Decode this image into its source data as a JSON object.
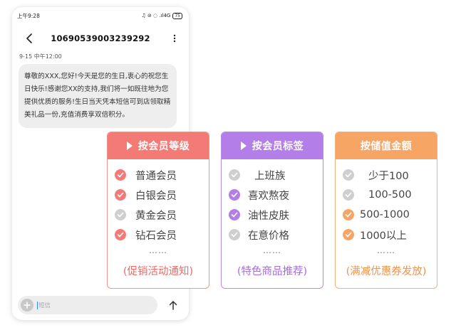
{
  "status_bar": {
    "time": "上午9:28",
    "icons": "♫ ⊘ ◌ .ıl4G",
    "battery": "75"
  },
  "header": {
    "title": "10690539003239292"
  },
  "conversation": {
    "date": "9-15  中午12:00",
    "message": "尊敬的XXX,您好!今天是您的生日,衷心的祝您生日快乐!感谢您XX的支持,我们将一如既往地为您提供优质的服务!生日当天凭本短信可到店领取精美礼品一份,充值消费享双倍积分。"
  },
  "composer": {
    "placeholder": "短信"
  },
  "cards": [
    {
      "title": "按会员等级",
      "accent": "#f47a76",
      "items": [
        {
          "label": "普通会员",
          "checked": true
        },
        {
          "label": "白银会员",
          "checked": true
        },
        {
          "label": "黄金会员",
          "checked": false
        },
        {
          "label": "钻石会员",
          "checked": true
        }
      ],
      "ellipsis": "……",
      "footer": "(促销活动通知)"
    },
    {
      "title": "按会员标签",
      "accent": "#b47ee8",
      "items": [
        {
          "label": "上班族",
          "checked": false
        },
        {
          "label": "喜欢熬夜",
          "checked": true
        },
        {
          "label": "油性皮肤",
          "checked": true
        },
        {
          "label": "在意价格",
          "checked": false
        }
      ],
      "ellipsis": "……",
      "footer": "(特色商品推荐)"
    },
    {
      "title": "按储值金额",
      "accent": "#f6a565",
      "items": [
        {
          "label": "少于100",
          "checked": false
        },
        {
          "label": "100-500",
          "checked": false
        },
        {
          "label": "500-1000",
          "checked": true
        },
        {
          "label": "1000以上",
          "checked": true
        }
      ],
      "ellipsis": "……",
      "footer": "(满减优惠券发放)"
    }
  ]
}
